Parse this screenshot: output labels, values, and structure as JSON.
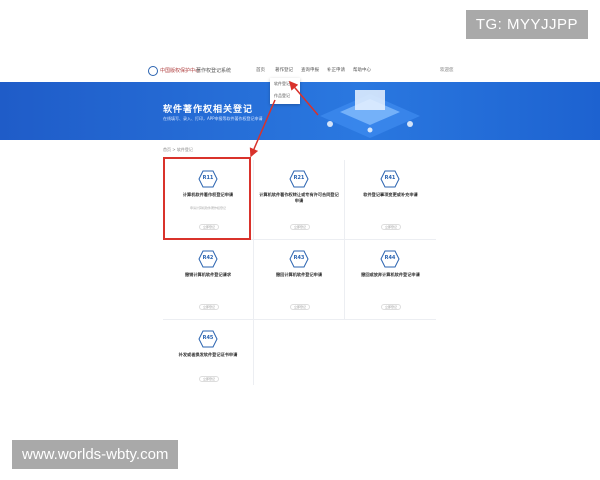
{
  "watermarks": {
    "top_right": "TG: MYYJJPP",
    "bottom_left": "www.worlds-wbty.com"
  },
  "header": {
    "logo": "中国版权保护中心",
    "subtitle": "著作权登记系统",
    "nav": [
      "首页",
      "著作登记",
      "查询申报",
      "补正申请",
      "帮助中心"
    ],
    "user": "欢迎您"
  },
  "dropdown": {
    "items": [
      "软件登记",
      "作品登记"
    ]
  },
  "banner": {
    "title": "软件著作权相关登记",
    "subtitle": "在线填写、录入、打印，APP申报等软件著作权登记申请"
  },
  "breadcrumb": "首页 > 软件登记",
  "cards": [
    {
      "code": "R11",
      "title": "计算机软件著作权登记申请",
      "desc": "申请计算机软件著作权登记",
      "button": "立即登记"
    },
    {
      "code": "R21",
      "title": "计算机软件著作权转让或专有许可合同登记申请",
      "desc": "",
      "button": "立即登记"
    },
    {
      "code": "R41",
      "title": "软件登记事项变更或补充申请",
      "desc": "",
      "button": "立即登记"
    },
    {
      "code": "R42",
      "title": "撤销计算机软件登记请求",
      "desc": "",
      "button": "立即登记"
    },
    {
      "code": "R43",
      "title": "撤回计算机软件登记申请",
      "desc": "",
      "button": "立即登记"
    },
    {
      "code": "R44",
      "title": "撤回或放弃计算机软件登记申请",
      "desc": "",
      "button": "立即登记"
    },
    {
      "code": "R45",
      "title": "补发或者换发软件登记证书申请",
      "desc": "",
      "button": "立即登记"
    }
  ],
  "colors": {
    "banner": "#1f5cc8",
    "accent": "#2a63b0",
    "highlight": "#d9322b"
  }
}
